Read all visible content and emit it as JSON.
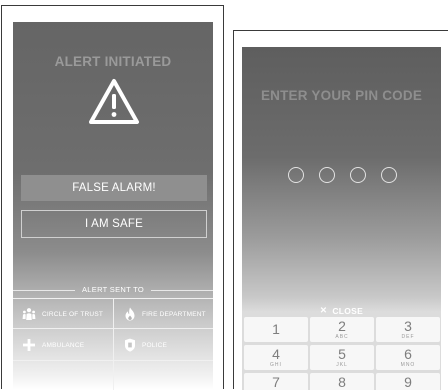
{
  "alert_screen": {
    "title": "ALERT INITIATED",
    "false_alarm_label": "FALSE ALARM!",
    "safe_label": "I AM SAFE",
    "alert_sent_label": "ALERT SENT TO",
    "recipients": [
      {
        "label": "CIRCLE OF TRUST",
        "icon": "people-icon"
      },
      {
        "label": "FIRE DEPARTMENT",
        "icon": "flame-icon"
      },
      {
        "label": "AMBULANCE",
        "icon": "plus-icon"
      },
      {
        "label": "POLICE",
        "icon": "badge-icon"
      }
    ]
  },
  "pin_screen": {
    "title": "ENTER YOUR PIN CODE",
    "pin_length": 4,
    "close_label": "CLOSE",
    "keys": [
      {
        "digit": "1",
        "letters": ""
      },
      {
        "digit": "2",
        "letters": "ABC"
      },
      {
        "digit": "3",
        "letters": "DEF"
      },
      {
        "digit": "4",
        "letters": "GHI"
      },
      {
        "digit": "5",
        "letters": "JKL"
      },
      {
        "digit": "6",
        "letters": "MNO"
      },
      {
        "digit": "7",
        "letters": ""
      },
      {
        "digit": "8",
        "letters": ""
      },
      {
        "digit": "9",
        "letters": ""
      }
    ]
  },
  "colors": {
    "screen_dark": "#656565",
    "button_fill": "#8f8f8f",
    "keypad_key": "#f7f7f7",
    "text_light": "#ffffff"
  }
}
